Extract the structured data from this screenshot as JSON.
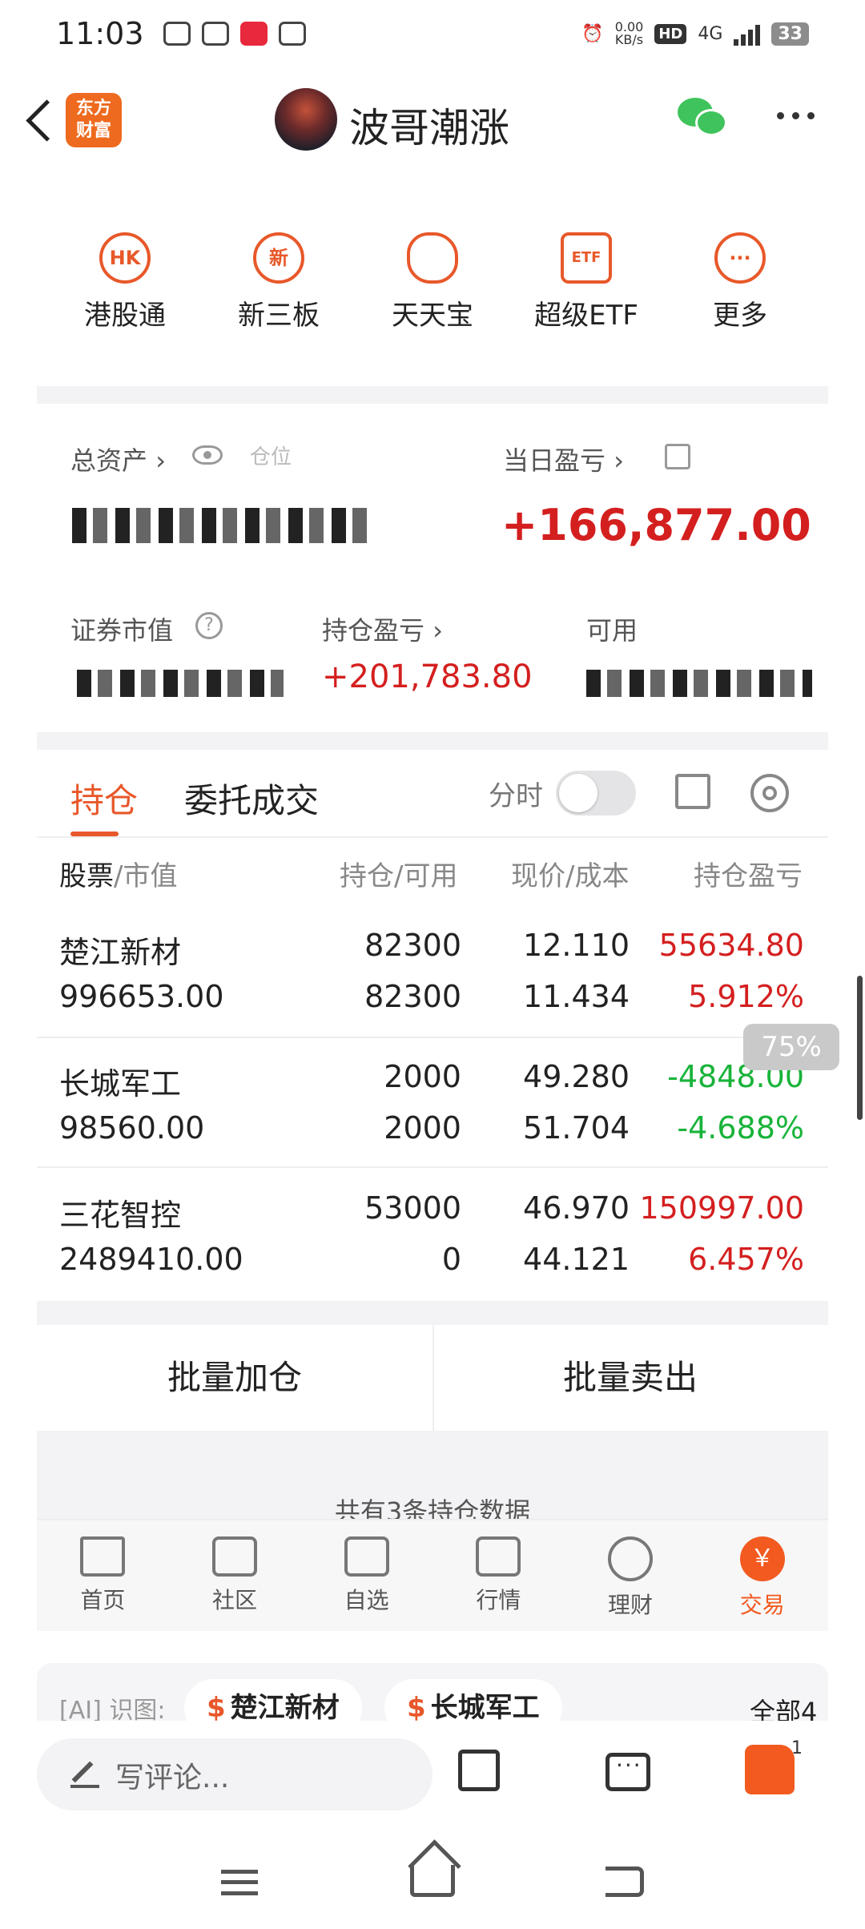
{
  "status": {
    "time": "11:03",
    "speed": "0.00\nKB/s",
    "hd": "HD",
    "net": "4G",
    "battery": "33"
  },
  "header": {
    "brand": "东方\n财富",
    "title": "波哥潮涨"
  },
  "quick": [
    {
      "icon": "HK",
      "label": "港股通"
    },
    {
      "icon": "新",
      "label": "新三板"
    },
    {
      "icon": "",
      "label": "天天宝"
    },
    {
      "icon": "ETF",
      "label": "超级ETF"
    },
    {
      "icon": "···",
      "label": "更多"
    }
  ],
  "asset": {
    "total_label": "总资产",
    "position_label": "仓位",
    "daily_pl_label": "当日盈亏",
    "daily_pl_value": "+166,877.00",
    "market_value_label": "证券市值",
    "holding_pl_label": "持仓盈亏",
    "holding_pl_value": "+201,783.80",
    "available_label": "可用"
  },
  "tabs": {
    "holdings": "持仓",
    "orders": "委托成交",
    "fenshi": "分时"
  },
  "table": {
    "headers": {
      "stock": "股票",
      "mv": "/市值",
      "qty": "持仓/可用",
      "price": "现价/成本",
      "pl": "持仓盈亏"
    },
    "rows": [
      {
        "name": "楚江新材",
        "mv": "996653.00",
        "qty": "82300",
        "avail": "82300",
        "price": "12.110",
        "cost": "11.434",
        "pl": "55634.80",
        "plpct": "5.912%",
        "dir": "up"
      },
      {
        "name": "长城军工",
        "mv": "98560.00",
        "qty": "2000",
        "avail": "2000",
        "price": "49.280",
        "cost": "51.704",
        "pl": "-4848.00",
        "plpct": "-4.688%",
        "dir": "down"
      },
      {
        "name": "三花智控",
        "mv": "2489410.00",
        "qty": "53000",
        "avail": "0",
        "price": "46.970",
        "cost": "44.121",
        "pl": "150997.00",
        "plpct": "6.457%",
        "dir": "up"
      }
    ],
    "zoom_badge": "75%"
  },
  "batch": {
    "add": "批量加仓",
    "sell": "批量卖出"
  },
  "summary": "共有3条持仓数据",
  "apptabs": [
    {
      "label": "首页",
      "icon": "home-icon"
    },
    {
      "label": "社区",
      "icon": "community-icon"
    },
    {
      "label": "自选",
      "icon": "watchlist-icon"
    },
    {
      "label": "行情",
      "icon": "market-icon"
    },
    {
      "label": "理财",
      "icon": "finance-icon"
    },
    {
      "label": "交易",
      "icon": "trade-icon",
      "glyph": "￥"
    }
  ],
  "ai": {
    "label": "识图:",
    "chip1": "楚江新材",
    "chip2": "长城军工",
    "all": "全部4 ▸"
  },
  "comment": {
    "placeholder": "写评论...",
    "likes": "1"
  },
  "colors": {
    "accent": "#e8582a",
    "up": "#d41f1f",
    "down": "#19b33a"
  }
}
